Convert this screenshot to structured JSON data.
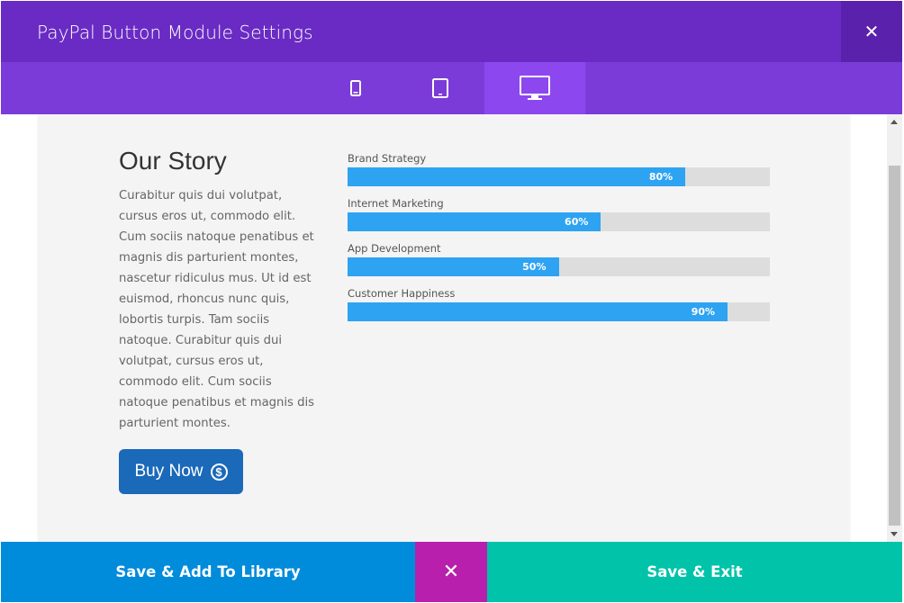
{
  "header": {
    "title": "PayPal Button Module Settings",
    "close_icon": "close-icon",
    "close_symbol": "✕"
  },
  "device_bar": {
    "devices": [
      {
        "icon": "phone-icon",
        "active": false
      },
      {
        "icon": "tablet-icon",
        "active": false
      },
      {
        "icon": "desktop-icon",
        "active": true
      }
    ]
  },
  "preview": {
    "story_title": "Our Story",
    "story_text": "Curabitur quis dui volutpat, cursus eros ut, commodo elit. Cum sociis natoque penatibus et magnis dis parturient montes, nascetur ridiculus mus. Ut id est euismod, rhoncus nunc quis, lobortis turpis. Tam sociis natoque. Curabitur quis dui volutpat, cursus eros ut, commodo elit. Cum sociis natoque penatibus et magnis dis parturient montes.",
    "buy_button": {
      "label": "Buy Now",
      "icon": "dollar-circle-icon",
      "symbol": "$"
    },
    "bars": [
      {
        "label": "Brand Strategy",
        "percent_text": "80%",
        "value": 0.8
      },
      {
        "label": "Internet Marketing",
        "percent_text": "60%",
        "value": 0.6
      },
      {
        "label": "App Development",
        "percent_text": "50%",
        "value": 0.5
      },
      {
        "label": "Customer Happiness",
        "percent_text": "90%",
        "value": 0.9
      }
    ]
  },
  "footer": {
    "save_library_label": "Save & Add To Library",
    "cancel_symbol": "✕",
    "cancel_icon": "close-icon",
    "save_exit_label": "Save & Exit"
  },
  "colors": {
    "title_bar": "#6a2bc4",
    "device_bar": "#7b3bd8",
    "device_active": "#8d47ee",
    "bar_fill": "#2ea3f2",
    "buy_button": "#1b69b9",
    "save_library": "#008bdb",
    "cancel": "#b71fac",
    "save_exit": "#00c3aa"
  }
}
